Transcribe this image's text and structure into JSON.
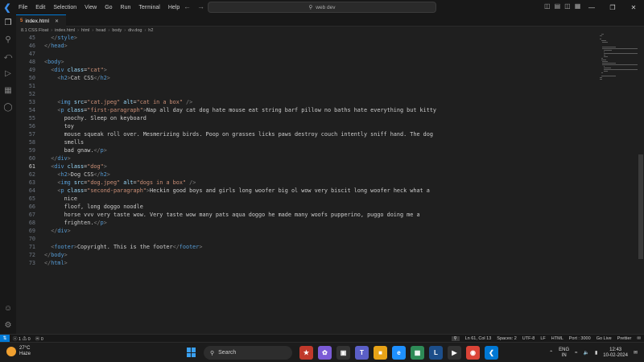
{
  "titlebar": {
    "menu": [
      "File",
      "Edit",
      "Selection",
      "View",
      "Go",
      "Run",
      "Terminal",
      "Help"
    ],
    "search": "web dev"
  },
  "tab": {
    "label": "index.html"
  },
  "breadcrumb": [
    "8.1 CSS Float",
    "index.html",
    "html",
    "head",
    "body",
    "div.dog",
    "h2"
  ],
  "editor": {
    "lines": [
      {
        "n": "45",
        "indent": 2,
        "segs": [
          [
            "tg",
            "</"
          ],
          [
            "tn",
            "style"
          ],
          [
            "tg",
            ">"
          ]
        ]
      },
      {
        "n": "46",
        "indent": 0,
        "segs": [
          [
            "tg",
            "</"
          ],
          [
            "tn",
            "head"
          ],
          [
            "tg",
            ">"
          ]
        ]
      },
      {
        "n": "47",
        "indent": 0,
        "segs": []
      },
      {
        "n": "48",
        "indent": 0,
        "segs": [
          [
            "tg",
            "<"
          ],
          [
            "tn",
            "body"
          ],
          [
            "tg",
            ">"
          ]
        ]
      },
      {
        "n": "49",
        "indent": 2,
        "segs": [
          [
            "tg",
            "<"
          ],
          [
            "tn",
            "div"
          ],
          [
            "tx",
            " "
          ],
          [
            "at",
            "class"
          ],
          [
            "tx",
            "="
          ],
          [
            "st",
            "\"cat\""
          ],
          [
            "tg",
            ">"
          ]
        ]
      },
      {
        "n": "50",
        "indent": 4,
        "segs": [
          [
            "tg",
            "<"
          ],
          [
            "tn",
            "h2"
          ],
          [
            "tg",
            ">"
          ],
          [
            "tx",
            "Cat CSS"
          ],
          [
            "tg",
            "</"
          ],
          [
            "tn",
            "h2"
          ],
          [
            "tg",
            ">"
          ]
        ]
      },
      {
        "n": "51",
        "indent": 0,
        "segs": []
      },
      {
        "n": "52",
        "indent": 0,
        "segs": []
      },
      {
        "n": "53",
        "indent": 4,
        "segs": [
          [
            "tg",
            "<"
          ],
          [
            "tn",
            "img"
          ],
          [
            "tx",
            " "
          ],
          [
            "at",
            "src"
          ],
          [
            "tx",
            "="
          ],
          [
            "st",
            "\"cat.jpeg\""
          ],
          [
            "tx",
            " "
          ],
          [
            "at",
            "alt"
          ],
          [
            "tx",
            "="
          ],
          [
            "st",
            "\"cat in a box\""
          ],
          [
            "tx",
            " "
          ],
          [
            "tg",
            "/>"
          ]
        ]
      },
      {
        "n": "54",
        "indent": 4,
        "segs": [
          [
            "tg",
            "<"
          ],
          [
            "tn",
            "p"
          ],
          [
            "tx",
            " "
          ],
          [
            "at",
            "class"
          ],
          [
            "tx",
            "="
          ],
          [
            "st",
            "\"first-paragraph\""
          ],
          [
            "tg",
            ">"
          ],
          [
            "tx",
            "Nap all day cat dog hate mouse eat string barf pillow no baths hate everything but kitty"
          ]
        ]
      },
      {
        "n": "55",
        "indent": 6,
        "segs": [
          [
            "tx",
            "poochy. Sleep on keyboard"
          ]
        ]
      },
      {
        "n": "56",
        "indent": 6,
        "segs": [
          [
            "tx",
            "toy"
          ]
        ]
      },
      {
        "n": "57",
        "indent": 6,
        "segs": [
          [
            "tx",
            "mouse squeak roll over. Mesmerizing birds. Poop on grasses licks paws destroy couch intently sniff hand. The dog"
          ]
        ]
      },
      {
        "n": "58",
        "indent": 6,
        "segs": [
          [
            "tx",
            "smells"
          ]
        ]
      },
      {
        "n": "59",
        "indent": 6,
        "segs": [
          [
            "tx",
            "bad gnaw."
          ],
          [
            "tg",
            "</"
          ],
          [
            "tn",
            "p"
          ],
          [
            "tg",
            ">"
          ]
        ]
      },
      {
        "n": "60",
        "indent": 2,
        "segs": [
          [
            "tg",
            "</"
          ],
          [
            "tn",
            "div"
          ],
          [
            "tg",
            ">"
          ]
        ]
      },
      {
        "n": "61",
        "indent": 2,
        "segs": [
          [
            "tg",
            "<"
          ],
          [
            "tn",
            "div"
          ],
          [
            "tx",
            " "
          ],
          [
            "at",
            "class"
          ],
          [
            "tx",
            "="
          ],
          [
            "st",
            "\"dog\""
          ],
          [
            "tg",
            ">"
          ]
        ]
      },
      {
        "n": "62",
        "indent": 4,
        "segs": [
          [
            "tg",
            "<"
          ],
          [
            "tn",
            "h2"
          ],
          [
            "tg",
            ">"
          ],
          [
            "tx",
            "Dog CSS"
          ],
          [
            "tg",
            "</"
          ],
          [
            "tn",
            "h2"
          ],
          [
            "tg",
            ">"
          ]
        ]
      },
      {
        "n": "63",
        "indent": 4,
        "segs": [
          [
            "tg",
            "<"
          ],
          [
            "tn",
            "img"
          ],
          [
            "tx",
            " "
          ],
          [
            "at",
            "src"
          ],
          [
            "tx",
            "="
          ],
          [
            "st",
            "\"dog.jpeg\""
          ],
          [
            "tx",
            " "
          ],
          [
            "at",
            "alt"
          ],
          [
            "tx",
            "="
          ],
          [
            "st",
            "\"dogs in a box\""
          ],
          [
            "tx",
            " "
          ],
          [
            "tg",
            "/>"
          ]
        ]
      },
      {
        "n": "64",
        "indent": 4,
        "segs": [
          [
            "tg",
            "<"
          ],
          [
            "tn",
            "p"
          ],
          [
            "tx",
            " "
          ],
          [
            "at",
            "class"
          ],
          [
            "tx",
            "="
          ],
          [
            "st",
            "\"second-paragraph\""
          ],
          [
            "tg",
            ">"
          ],
          [
            "tx",
            "Heckin good boys and girls long woofer big ol wow very biscit long woofer heck what a"
          ]
        ]
      },
      {
        "n": "65",
        "indent": 6,
        "segs": [
          [
            "tx",
            "nice"
          ]
        ]
      },
      {
        "n": "66",
        "indent": 6,
        "segs": [
          [
            "tx",
            "floof, long doggo noodle"
          ]
        ]
      },
      {
        "n": "67",
        "indent": 6,
        "segs": [
          [
            "tx",
            "horse vvv very taste wow. Very taste wow many pats aqua doggo he made many woofs pupperino, puggo doing me a"
          ]
        ]
      },
      {
        "n": "68",
        "indent": 6,
        "segs": [
          [
            "tx",
            "frighten."
          ],
          [
            "tg",
            "</"
          ],
          [
            "tn",
            "p"
          ],
          [
            "tg",
            ">"
          ]
        ]
      },
      {
        "n": "69",
        "indent": 2,
        "segs": [
          [
            "tg",
            "</"
          ],
          [
            "tn",
            "div"
          ],
          [
            "tg",
            ">"
          ]
        ]
      },
      {
        "n": "70",
        "indent": 0,
        "segs": []
      },
      {
        "n": "71",
        "indent": 2,
        "segs": [
          [
            "tg",
            "<"
          ],
          [
            "tn",
            "footer"
          ],
          [
            "tg",
            ">"
          ],
          [
            "tx",
            "Copyright. This is the footer"
          ],
          [
            "tg",
            "</"
          ],
          [
            "tn",
            "footer"
          ],
          [
            "tg",
            ">"
          ]
        ]
      },
      {
        "n": "72",
        "indent": 0,
        "segs": [
          [
            "tg",
            "</"
          ],
          [
            "tn",
            "body"
          ],
          [
            "tg",
            ">"
          ]
        ]
      },
      {
        "n": "73",
        "indent": 0,
        "segs": [
          [
            "tg",
            "</"
          ],
          [
            "tn",
            "html"
          ],
          [
            "tg",
            ">"
          ]
        ]
      }
    ],
    "current_line": "61"
  },
  "status": {
    "problems": "ⓧ 1 ⚠ 0",
    "ports": "ⓦ 0",
    "position": "Ln 61, Col 13",
    "spaces": "Spaces: 2",
    "encoding": "UTF-8",
    "eol": "LF",
    "language": "HTML",
    "port": "Port : 3000",
    "golive": "Go Live",
    "prettier": "Prettier"
  },
  "taskbar": {
    "temp": "27°C",
    "weather": "Haze",
    "search": "Search",
    "lang1": "ENG",
    "lang2": "IN",
    "time": "12:43",
    "date": "10-02-2024"
  },
  "colors": {
    "accent": "#0078d4",
    "background": "#1f1f1f"
  }
}
